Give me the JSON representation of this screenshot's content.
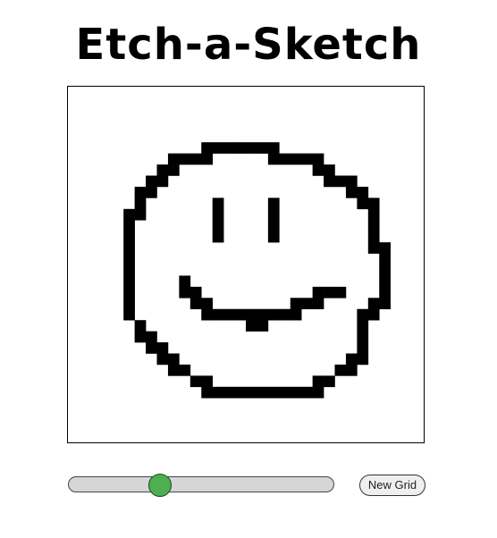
{
  "header": {
    "title": "Etch-a-Sketch"
  },
  "grid": {
    "size": 32,
    "fill_color": "#000000",
    "background": "#ffffff",
    "filled_cells": [
      [
        12,
        5
      ],
      [
        13,
        5
      ],
      [
        14,
        5
      ],
      [
        15,
        5
      ],
      [
        16,
        5
      ],
      [
        17,
        5
      ],
      [
        18,
        5
      ],
      [
        9,
        6
      ],
      [
        10,
        6
      ],
      [
        11,
        6
      ],
      [
        12,
        6
      ],
      [
        18,
        6
      ],
      [
        19,
        6
      ],
      [
        20,
        6
      ],
      [
        21,
        6
      ],
      [
        22,
        6
      ],
      [
        8,
        7
      ],
      [
        9,
        7
      ],
      [
        22,
        7
      ],
      [
        23,
        7
      ],
      [
        7,
        8
      ],
      [
        8,
        7
      ],
      [
        8,
        8
      ],
      [
        23,
        8
      ],
      [
        24,
        8
      ],
      [
        25,
        8
      ],
      [
        6,
        9
      ],
      [
        7,
        9
      ],
      [
        25,
        9
      ],
      [
        26,
        9
      ],
      [
        6,
        10
      ],
      [
        26,
        10
      ],
      [
        27,
        10
      ],
      [
        13,
        10
      ],
      [
        13,
        11
      ],
      [
        13,
        12
      ],
      [
        13,
        13
      ],
      [
        18,
        10
      ],
      [
        18,
        11
      ],
      [
        18,
        12
      ],
      [
        18,
        13
      ],
      [
        5,
        11
      ],
      [
        6,
        11
      ],
      [
        27,
        11
      ],
      [
        5,
        12
      ],
      [
        27,
        12
      ],
      [
        5,
        13
      ],
      [
        27,
        13
      ],
      [
        5,
        14
      ],
      [
        27,
        14
      ],
      [
        28,
        14
      ],
      [
        5,
        15
      ],
      [
        28,
        15
      ],
      [
        5,
        16
      ],
      [
        28,
        16
      ],
      [
        5,
        17
      ],
      [
        10,
        17
      ],
      [
        28,
        17
      ],
      [
        5,
        18
      ],
      [
        10,
        18
      ],
      [
        11,
        18
      ],
      [
        22,
        18
      ],
      [
        23,
        18
      ],
      [
        24,
        18
      ],
      [
        28,
        18
      ],
      [
        5,
        19
      ],
      [
        11,
        19
      ],
      [
        12,
        19
      ],
      [
        20,
        19
      ],
      [
        21,
        19
      ],
      [
        22,
        19
      ],
      [
        27,
        19
      ],
      [
        28,
        19
      ],
      [
        5,
        20
      ],
      [
        12,
        20
      ],
      [
        13,
        20
      ],
      [
        14,
        20
      ],
      [
        15,
        20
      ],
      [
        16,
        20
      ],
      [
        17,
        20
      ],
      [
        18,
        20
      ],
      [
        19,
        20
      ],
      [
        20,
        20
      ],
      [
        26,
        20
      ],
      [
        27,
        20
      ],
      [
        16,
        21
      ],
      [
        17,
        21
      ],
      [
        26,
        21
      ],
      [
        6,
        21
      ],
      [
        6,
        22
      ],
      [
        7,
        22
      ],
      [
        26,
        22
      ],
      [
        7,
        23
      ],
      [
        8,
        23
      ],
      [
        26,
        23
      ],
      [
        8,
        24
      ],
      [
        9,
        24
      ],
      [
        25,
        24
      ],
      [
        26,
        24
      ],
      [
        9,
        25
      ],
      [
        10,
        25
      ],
      [
        24,
        25
      ],
      [
        25,
        25
      ],
      [
        11,
        26
      ],
      [
        12,
        26
      ],
      [
        22,
        26
      ],
      [
        23,
        26
      ],
      [
        12,
        27
      ],
      [
        13,
        27
      ],
      [
        14,
        27
      ],
      [
        15,
        27
      ],
      [
        16,
        27
      ],
      [
        17,
        27
      ],
      [
        18,
        27
      ],
      [
        19,
        27
      ],
      [
        20,
        27
      ],
      [
        21,
        27
      ],
      [
        22,
        27
      ]
    ]
  },
  "controls": {
    "slider": {
      "value_fraction": 0.33
    },
    "new_grid_label": "New Grid"
  }
}
